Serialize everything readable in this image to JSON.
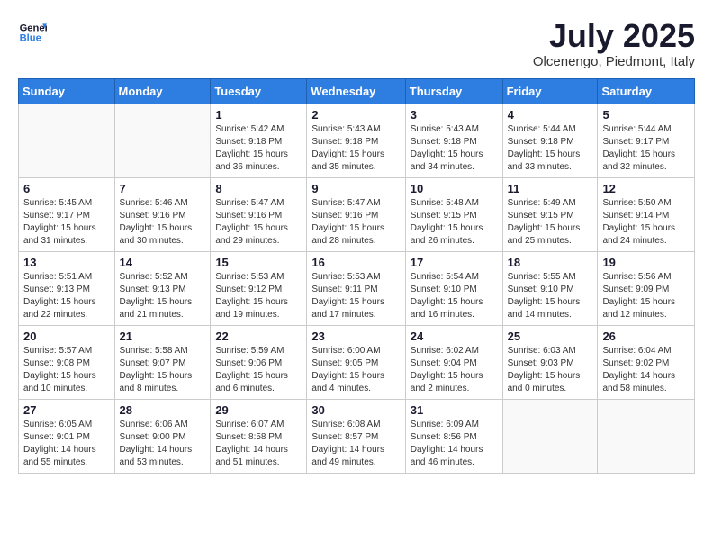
{
  "header": {
    "logo_line1": "General",
    "logo_line2": "Blue",
    "month_year": "July 2025",
    "location": "Olcenengo, Piedmont, Italy"
  },
  "days_of_week": [
    "Sunday",
    "Monday",
    "Tuesday",
    "Wednesday",
    "Thursday",
    "Friday",
    "Saturday"
  ],
  "weeks": [
    [
      {
        "day": "",
        "info": ""
      },
      {
        "day": "",
        "info": ""
      },
      {
        "day": "1",
        "info": "Sunrise: 5:42 AM\nSunset: 9:18 PM\nDaylight: 15 hours and 36 minutes."
      },
      {
        "day": "2",
        "info": "Sunrise: 5:43 AM\nSunset: 9:18 PM\nDaylight: 15 hours and 35 minutes."
      },
      {
        "day": "3",
        "info": "Sunrise: 5:43 AM\nSunset: 9:18 PM\nDaylight: 15 hours and 34 minutes."
      },
      {
        "day": "4",
        "info": "Sunrise: 5:44 AM\nSunset: 9:18 PM\nDaylight: 15 hours and 33 minutes."
      },
      {
        "day": "5",
        "info": "Sunrise: 5:44 AM\nSunset: 9:17 PM\nDaylight: 15 hours and 32 minutes."
      }
    ],
    [
      {
        "day": "6",
        "info": "Sunrise: 5:45 AM\nSunset: 9:17 PM\nDaylight: 15 hours and 31 minutes."
      },
      {
        "day": "7",
        "info": "Sunrise: 5:46 AM\nSunset: 9:16 PM\nDaylight: 15 hours and 30 minutes."
      },
      {
        "day": "8",
        "info": "Sunrise: 5:47 AM\nSunset: 9:16 PM\nDaylight: 15 hours and 29 minutes."
      },
      {
        "day": "9",
        "info": "Sunrise: 5:47 AM\nSunset: 9:16 PM\nDaylight: 15 hours and 28 minutes."
      },
      {
        "day": "10",
        "info": "Sunrise: 5:48 AM\nSunset: 9:15 PM\nDaylight: 15 hours and 26 minutes."
      },
      {
        "day": "11",
        "info": "Sunrise: 5:49 AM\nSunset: 9:15 PM\nDaylight: 15 hours and 25 minutes."
      },
      {
        "day": "12",
        "info": "Sunrise: 5:50 AM\nSunset: 9:14 PM\nDaylight: 15 hours and 24 minutes."
      }
    ],
    [
      {
        "day": "13",
        "info": "Sunrise: 5:51 AM\nSunset: 9:13 PM\nDaylight: 15 hours and 22 minutes."
      },
      {
        "day": "14",
        "info": "Sunrise: 5:52 AM\nSunset: 9:13 PM\nDaylight: 15 hours and 21 minutes."
      },
      {
        "day": "15",
        "info": "Sunrise: 5:53 AM\nSunset: 9:12 PM\nDaylight: 15 hours and 19 minutes."
      },
      {
        "day": "16",
        "info": "Sunrise: 5:53 AM\nSunset: 9:11 PM\nDaylight: 15 hours and 17 minutes."
      },
      {
        "day": "17",
        "info": "Sunrise: 5:54 AM\nSunset: 9:10 PM\nDaylight: 15 hours and 16 minutes."
      },
      {
        "day": "18",
        "info": "Sunrise: 5:55 AM\nSunset: 9:10 PM\nDaylight: 15 hours and 14 minutes."
      },
      {
        "day": "19",
        "info": "Sunrise: 5:56 AM\nSunset: 9:09 PM\nDaylight: 15 hours and 12 minutes."
      }
    ],
    [
      {
        "day": "20",
        "info": "Sunrise: 5:57 AM\nSunset: 9:08 PM\nDaylight: 15 hours and 10 minutes."
      },
      {
        "day": "21",
        "info": "Sunrise: 5:58 AM\nSunset: 9:07 PM\nDaylight: 15 hours and 8 minutes."
      },
      {
        "day": "22",
        "info": "Sunrise: 5:59 AM\nSunset: 9:06 PM\nDaylight: 15 hours and 6 minutes."
      },
      {
        "day": "23",
        "info": "Sunrise: 6:00 AM\nSunset: 9:05 PM\nDaylight: 15 hours and 4 minutes."
      },
      {
        "day": "24",
        "info": "Sunrise: 6:02 AM\nSunset: 9:04 PM\nDaylight: 15 hours and 2 minutes."
      },
      {
        "day": "25",
        "info": "Sunrise: 6:03 AM\nSunset: 9:03 PM\nDaylight: 15 hours and 0 minutes."
      },
      {
        "day": "26",
        "info": "Sunrise: 6:04 AM\nSunset: 9:02 PM\nDaylight: 14 hours and 58 minutes."
      }
    ],
    [
      {
        "day": "27",
        "info": "Sunrise: 6:05 AM\nSunset: 9:01 PM\nDaylight: 14 hours and 55 minutes."
      },
      {
        "day": "28",
        "info": "Sunrise: 6:06 AM\nSunset: 9:00 PM\nDaylight: 14 hours and 53 minutes."
      },
      {
        "day": "29",
        "info": "Sunrise: 6:07 AM\nSunset: 8:58 PM\nDaylight: 14 hours and 51 minutes."
      },
      {
        "day": "30",
        "info": "Sunrise: 6:08 AM\nSunset: 8:57 PM\nDaylight: 14 hours and 49 minutes."
      },
      {
        "day": "31",
        "info": "Sunrise: 6:09 AM\nSunset: 8:56 PM\nDaylight: 14 hours and 46 minutes."
      },
      {
        "day": "",
        "info": ""
      },
      {
        "day": "",
        "info": ""
      }
    ]
  ]
}
